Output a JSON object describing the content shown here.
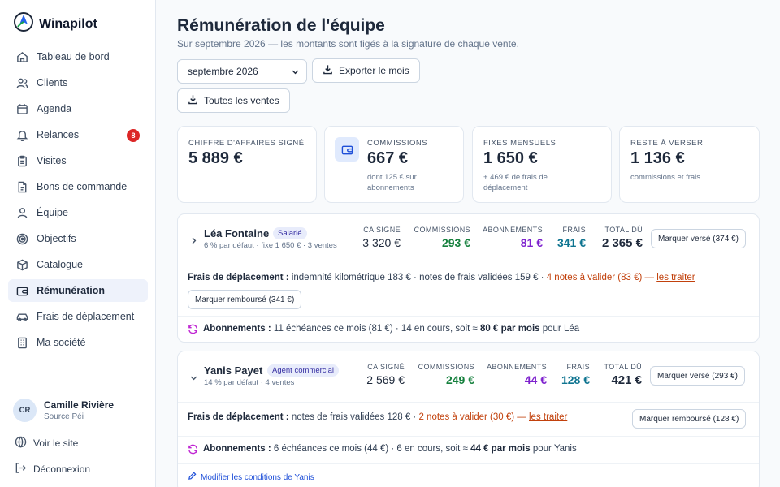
{
  "app": {
    "name": "Winapilot"
  },
  "sidebar": {
    "items": [
      {
        "label": "Tableau de bord",
        "icon": "home-icon"
      },
      {
        "label": "Clients",
        "icon": "users-icon"
      },
      {
        "label": "Agenda",
        "icon": "calendar-icon"
      },
      {
        "label": "Relances",
        "icon": "bell-icon",
        "badge": "8"
      },
      {
        "label": "Visites",
        "icon": "clipboard-icon"
      },
      {
        "label": "Bons de commande",
        "icon": "file-icon"
      },
      {
        "label": "Équipe",
        "icon": "user-icon"
      },
      {
        "label": "Objectifs",
        "icon": "target-icon"
      },
      {
        "label": "Catalogue",
        "icon": "package-icon"
      },
      {
        "label": "Rémunération",
        "icon": "wallet-icon",
        "active": true
      },
      {
        "label": "Frais de déplacement",
        "icon": "car-icon"
      },
      {
        "label": "Ma société",
        "icon": "building-icon"
      }
    ],
    "user": {
      "initials": "CR",
      "name": "Camille Rivière",
      "org": "Source Péi"
    },
    "view_site": "Voir le site",
    "logout": "Déconnexion"
  },
  "page": {
    "title": "Rémunération de l'équipe",
    "subtitle": "Sur septembre 2026 — les montants sont figés à la signature de chaque vente.",
    "month_selected": "septembre 2026",
    "export_label": "Exporter le mois",
    "all_sales_label": "Toutes les ventes"
  },
  "kpis": [
    {
      "label": "CHIFFRE D'AFFAIRES SIGNÉ",
      "value": "5 889 €",
      "note": ""
    },
    {
      "label": "COMMISSIONS",
      "value": "667 €",
      "note": "dont 125 € sur abonnements"
    },
    {
      "label": "FIXES MENSUELS",
      "value": "1 650 €",
      "note": "+ 469 € de frais de déplacement"
    },
    {
      "label": "RESTE À VERSER",
      "value": "1 136 €",
      "note": "commissions et frais"
    }
  ],
  "stat_labels": {
    "ca": "CA SIGNÉ",
    "commissions": "COMMISSIONS",
    "abonnements": "ABONNEMENTS",
    "frais": "FRAIS",
    "total": "TOTAL DÛ"
  },
  "colors": {
    "commissions": "#15803d",
    "abonnements": "#7e22ce",
    "frais": "#0e7490",
    "accent": "#1d4ed8",
    "warn": "#c2410c"
  },
  "employees": [
    {
      "name": "Léa Fontaine",
      "role": "Salarié",
      "meta": "6 % par défaut · fixe 1 650 € · 3 ventes",
      "ca": "3 320 €",
      "commissions": "293 €",
      "abonnements": "81 €",
      "frais": "341 €",
      "total": "2 365 €",
      "pay_button": "Marquer versé (374 €)",
      "frais_label": "Frais de déplacement :",
      "frais_text": "indemnité kilométrique 183 € · notes de frais validées 159 € ·",
      "frais_warn": "4 notes à valider (83 €) —",
      "frais_link": "les traiter",
      "reimburse_button": "Marquer remboursé (341 €)",
      "subs_label": "Abonnements :",
      "subs_text": "11 échéances ce mois (81 €)  · 14 en cours, soit ≈",
      "subs_strong": "80 € par mois",
      "subs_suffix": "pour Léa"
    },
    {
      "name": "Yanis Payet",
      "role": "Agent commercial",
      "meta": "14 % par défaut · 4 ventes",
      "ca": "2 569 €",
      "commissions": "249 €",
      "abonnements": "44 €",
      "frais": "128 €",
      "total": "421 €",
      "pay_button": "Marquer versé (293 €)",
      "frais_label": "Frais de déplacement :",
      "frais_text": "notes de frais validées 128 € ·",
      "frais_warn": "2 notes à valider (30 €) —",
      "frais_link": "les traiter",
      "reimburse_button": "Marquer remboursé (128 €)",
      "subs_label": "Abonnements :",
      "subs_text": "6 échéances ce mois (44 €)  · 6 en cours, soit ≈",
      "subs_strong": "44 € par mois",
      "subs_suffix": "pour Yanis",
      "edit_link": "Modifier les conditions de Yanis"
    }
  ]
}
